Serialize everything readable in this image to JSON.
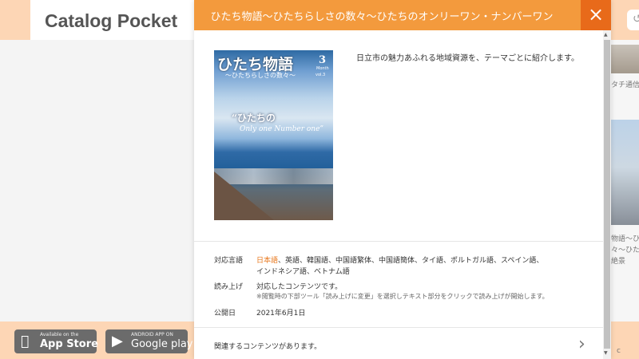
{
  "app": {
    "title": "Catalog Pocket"
  },
  "header": {
    "share_icon": "share-icon"
  },
  "background": {
    "right_items": [
      "タチ通信",
      "物語〜ひ",
      "々〜ひた",
      "絶景"
    ]
  },
  "footer": {
    "app_store": {
      "small": "Available on the",
      "big": "App Store"
    },
    "google_play": {
      "small": "ANDROID APP ON",
      "big": "Google play"
    },
    "right_text": "c"
  },
  "modal": {
    "title": "ひたち物語〜ひたちらしさの数々〜ひたちのオンリーワン・ナンバーワン",
    "close_icon": "×",
    "cover": {
      "title": "ひたち物語",
      "subtitle": "〜ひたちらしさの数々〜",
      "issue_number": "3",
      "month": "Month",
      "vol": "vol.3",
      "headline": "“ひたちの",
      "english": "Only one Number one”"
    },
    "description": "日立市の魅力あふれる地域資源を、テーマごとに紹介します。",
    "info": {
      "languages_label": "対応言語",
      "languages_highlight": "日本語",
      "languages_line1": "、英語、韓国語、中国語繁体、中国語簡体、タイ語、ポルトガル語、スペイン語、",
      "languages_line2": "インドネシア語、ベトナム語",
      "read_label": "読み上げ",
      "read_value": "対応したコンテンツです。",
      "read_note": "※閲覧時の下部ツール「読み上げに変更」を選択しテキスト部分をクリックで読み上げが開始します。",
      "published_label": "公開日",
      "published_value": "2021年6月1日"
    },
    "related": {
      "text": "関連するコンテンツがあります。",
      "chevron": "›"
    }
  }
}
